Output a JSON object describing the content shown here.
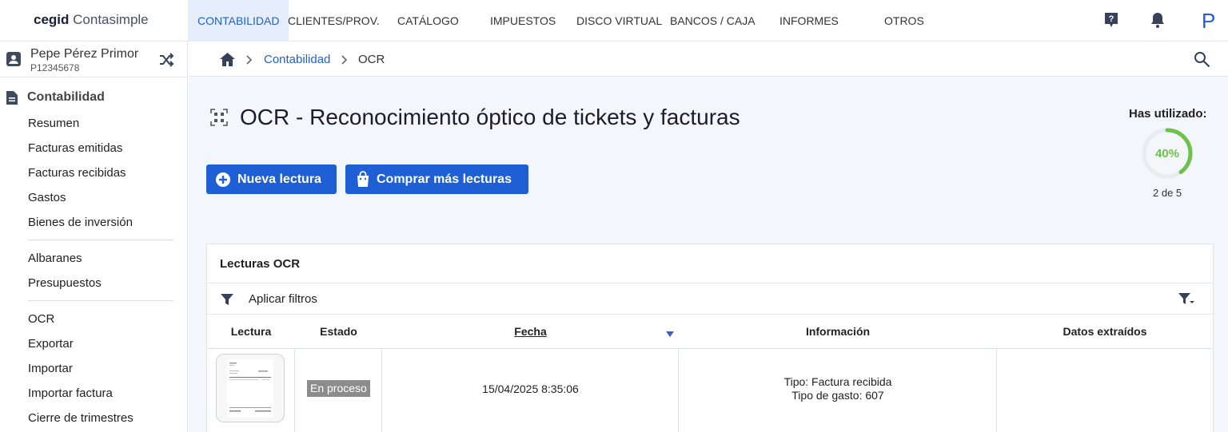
{
  "logo": {
    "brand": "cegid",
    "product": "Contasimple"
  },
  "nav": {
    "items": [
      "CONTABILIDAD",
      "CLIENTES/PROV.",
      "CATÁLOGO",
      "IMPUESTOS",
      "DISCO VIRTUAL",
      "BANCOS / CAJA",
      "INFORMES",
      "OTROS"
    ],
    "avatar_letter": "P",
    "icons": [
      "help-icon",
      "bell-icon"
    ]
  },
  "user": {
    "name": "Pepe Pérez Primor",
    "id": "P12345678"
  },
  "sidebar": {
    "section": "Contabilidad",
    "group1": [
      "Resumen",
      "Facturas emitidas",
      "Facturas recibidas",
      "Gastos",
      "Bienes de inversión"
    ],
    "group2": [
      "Albaranes",
      "Presupuestos"
    ],
    "group3": [
      "OCR",
      "Exportar",
      "Importar",
      "Importar factura",
      "Cierre de trimestres"
    ]
  },
  "breadcrumb": {
    "items": [
      "Contabilidad",
      "OCR"
    ]
  },
  "page": {
    "title": "OCR - Reconocimiento óptico de tickets y facturas",
    "new_button": "Nueva lectura",
    "buy_button": "Comprar más lecturas"
  },
  "usage": {
    "label": "Has utilizado:",
    "percent_text": "40%",
    "percent": 40,
    "used_text": "2 de 5"
  },
  "table": {
    "title": "Lecturas OCR",
    "filter_label": "Aplicar filtros",
    "headers": [
      "Lectura",
      "Estado",
      "Fecha",
      "Información",
      "Datos extraídos"
    ],
    "rows": [
      {
        "status": "En proceso",
        "date": "15/04/2025 8:35:06",
        "info_line1": "Tipo: Factura recibida",
        "info_line2": "Tipo de gasto: 607",
        "extracted": ""
      }
    ]
  },
  "colors": {
    "accent": "#1f5fd6",
    "usage_ring": "#6cc24a",
    "badge": "#8c8c8c"
  }
}
